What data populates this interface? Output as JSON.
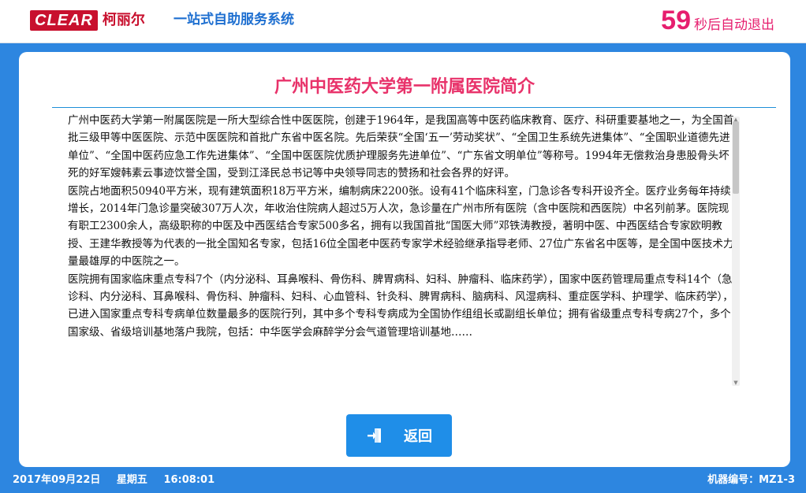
{
  "header": {
    "logo_text": "CLEAR",
    "logo_cn": "柯丽尔",
    "slogan": "一站式自助服务系统",
    "countdown_seconds": "59",
    "countdown_text": "秒后自动退出"
  },
  "article": {
    "title": "广州中医药大学第一附属医院简介",
    "paragraphs": [
      "广州中医药大学第一附属医院是一所大型综合性中医医院，创建于1964年，是我国高等中医药临床教育、医疗、科研重要基地之一，为全国首批三级甲等中医医院、示范中医医院和首批广东省中医名院。先后荣获“全国‘五一’劳动奖状”、“全国卫生系统先进集体”、“全国职业道德先进单位”、“全国中医药应急工作先进集体”、“全国中医医院优质护理服务先进单位”、“广东省文明单位”等称号。1994年无偿救治身患股骨头坏死的好军嫂韩素云事迹饮誉全国，受到江泽民总书记等中央领导同志的赞扬和社会各界的好评。",
      "医院占地面积50940平方米，现有建筑面积18万平方米，编制病床2200张。设有41个临床科室，门急诊各专科开设齐全。医疗业务每年持续增长，2014年门急诊量突破307万人次，年收治住院病人超过5万人次，急诊量在广州市所有医院（含中医院和西医院）中名列前茅。医院现有职工2300余人，高级职称的中医及中西医结合专家500多名，拥有以我国首批“国医大师”邓铁涛教授，著明中医、中西医结合专家欧明教授、王建华教授等为代表的一批全国知名专家，包括16位全国老中医药专家学术经验继承指导老师、27位广东省名中医等，是全国中医技术力量最雄厚的中医院之一。",
      "医院拥有国家临床重点专科7个（内分泌科、耳鼻喉科、骨伤科、脾胃病科、妇科、肿瘤科、临床药学），国家中医药管理局重点专科14个（急诊科、内分泌科、耳鼻喉科、骨伤科、肿瘤科、妇科、心血管科、针灸科、脾胃病科、脑病科、风湿病科、重症医学科、护理学、临床药学），已进入国家重点专科专病单位数量最多的医院行列，其中多个专科专病成为全国协作组组长或副组长单位；拥有省级重点专科专病27个，多个国家级、省级培训基地落户我院，包括：中华医学会麻醉学分会气道管理培训基地……"
    ]
  },
  "buttons": {
    "back_label": "返回"
  },
  "footer": {
    "date": "2017年09月22日",
    "weekday": "星期五",
    "time": "16:08:01",
    "machine_id": "机器编号：MZ1-3"
  },
  "colors": {
    "accent_blue": "#2d86e0",
    "title_pink": "#e8326a",
    "brand_red": "#c8102e"
  },
  "icons": {
    "back": "exit-door-icon"
  }
}
